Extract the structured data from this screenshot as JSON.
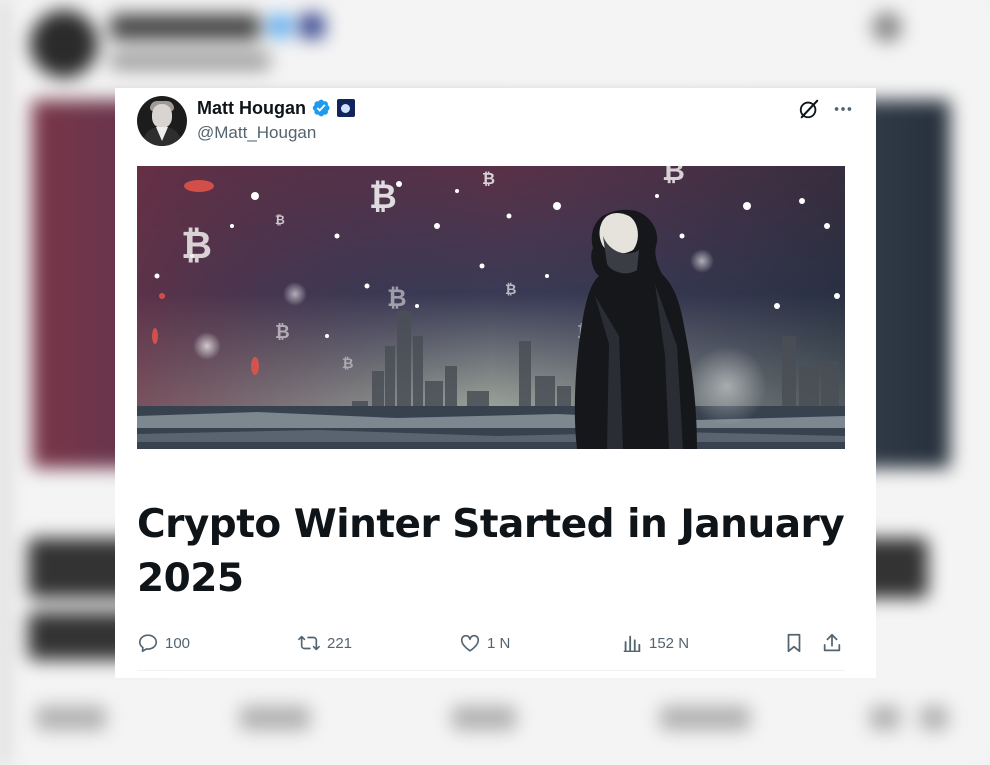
{
  "post": {
    "author": {
      "display_name": "Matt Hougan",
      "handle": "@Matt_Hougan",
      "verified": true,
      "avatar": "avatar-photo",
      "affiliate_badge": "affiliate-badge-icon"
    },
    "header_icons": [
      "grok-icon",
      "more-icon"
    ],
    "media": {
      "description_icon": "article-cover-image",
      "colors": {
        "sky_top": "#5a3147",
        "sky_mid": "#3a3a55",
        "ground": "#2b3340"
      }
    },
    "article_title": "Crypto Winter Started in January 2025",
    "stats": {
      "replies": "100",
      "reposts": "221",
      "likes": "1 N",
      "views": "152 N"
    }
  },
  "colors": {
    "text_primary": "#0f1419",
    "text_secondary": "#536471",
    "verified_blue": "#1d9bf0"
  }
}
